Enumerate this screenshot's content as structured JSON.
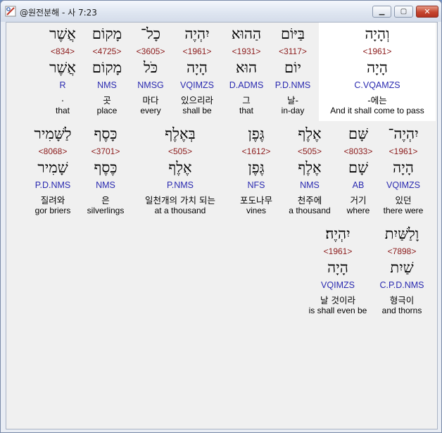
{
  "window": {
    "title": "@원전분해 - 사 7:23",
    "minimize_glyph": "▁",
    "maximize_glyph": "▢",
    "close_glyph": "✕"
  },
  "rows": [
    {
      "words": [
        {
          "hebrew": "וְהָיָה",
          "strong": "<1961>",
          "lemma": "הָיָה",
          "morph": "C.VQAMZS",
          "korean": "-에는",
          "english": "And it shall come to pass",
          "highlight": true
        },
        {
          "hebrew": "בַּיּוֹם",
          "strong": "<3117>",
          "lemma": "יוֹם",
          "morph": "P.D.NMS",
          "korean": "날-",
          "english": "in-day"
        },
        {
          "hebrew": "הַהוּא",
          "strong": "<1931>",
          "lemma": "הוּא",
          "morph": "D.ADMS",
          "korean": "그",
          "english": "that"
        },
        {
          "hebrew": "יִהְיֶה",
          "strong": "<1961>",
          "lemma": "הָיָה",
          "morph": "VQIMZS",
          "korean": "있으리라",
          "english": "shall be"
        },
        {
          "hebrew": "כָל־",
          "strong": "<3605>",
          "lemma": "כֹּל",
          "morph": "NMSG",
          "korean": "마다",
          "english": "every"
        },
        {
          "hebrew": "מָקוֹם",
          "strong": "<4725>",
          "lemma": "מָקוֹם",
          "morph": "NMS",
          "korean": "곳",
          "english": "place"
        },
        {
          "hebrew": "אֲשֶׁר",
          "strong": "<834>",
          "lemma": "אֲשֶׁר",
          "morph": "R",
          "korean": ".",
          "english": "that"
        }
      ]
    },
    {
      "words": [
        {
          "hebrew": "יִהְיֶה־",
          "strong": "<1961>",
          "lemma": "הָיָה",
          "morph": "VQIMZS",
          "korean": "있던",
          "english": "there were"
        },
        {
          "hebrew": "שָּׁם",
          "strong": "<8033>",
          "lemma": "שָׁם",
          "morph": "AB",
          "korean": "거기",
          "english": "where"
        },
        {
          "hebrew": "אֶלֶף",
          "strong": "<505>",
          "lemma": "אֶלֶף",
          "morph": "NMS",
          "korean": "천주에",
          "english": "a thousand"
        },
        {
          "hebrew": "גֶּפֶן",
          "strong": "<1612>",
          "lemma": "גֶּפֶן",
          "morph": "NFS",
          "korean": "포도나무",
          "english": "vines"
        },
        {
          "hebrew": "בְּאֶלֶף",
          "strong": "<505>",
          "lemma": "אֶלֶף",
          "morph": "P.NMS",
          "korean": "일천개의 가치 되는",
          "english": "at a thousand"
        },
        {
          "hebrew": "כָּסֶף",
          "strong": "<3701>",
          "lemma": "כֶּסֶף",
          "morph": "NMS",
          "korean": "은",
          "english": "silverlings"
        },
        {
          "hebrew": "לַשָּׁמִיר",
          "strong": "<8068>",
          "lemma": "שָׁמִיר",
          "morph": "P.D.NMS",
          "korean": "질려와",
          "english": "gor briers"
        }
      ]
    },
    {
      "words": [
        {
          "hebrew": "וָלַשַּׁיִת",
          "strong": "<7898>",
          "lemma": "שַׁיִת",
          "morph": "C.P.D.NMS",
          "korean": "형극이",
          "english": "and thorns"
        },
        {
          "hebrew": "יִהְיֶה׃",
          "strong": "<1961>",
          "lemma": "הָיָה",
          "morph": "VQIMZS",
          "korean": "날 것이라",
          "english": "is shall even be"
        }
      ]
    }
  ]
}
